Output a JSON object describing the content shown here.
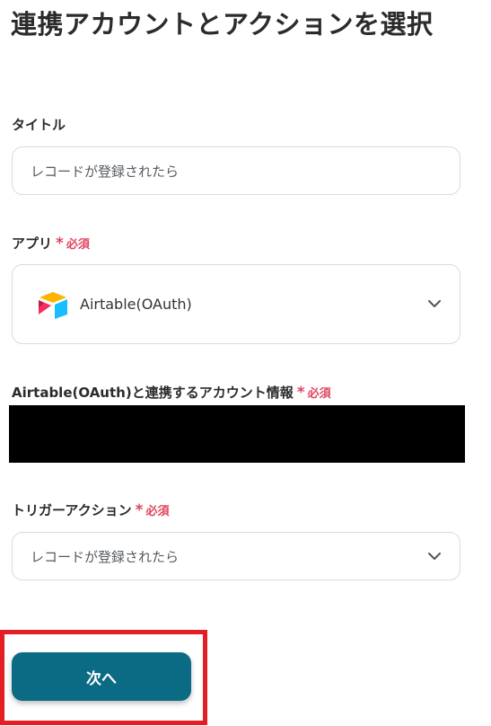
{
  "page": {
    "title": "連携アカウントとアクションを選択"
  },
  "title_field": {
    "label": "タイトル",
    "value": "レコードが登録されたら"
  },
  "app_field": {
    "label": "アプリ",
    "required_mark": "*",
    "required_text": "必須",
    "selected_app": "Airtable(OAuth)",
    "logo_icon": "airtable-logo-icon"
  },
  "account_field": {
    "label": "Airtable(OAuth)と連携するアカウント情報",
    "required_mark": "*",
    "required_text": "必須"
  },
  "trigger_field": {
    "label": "トリガーアクション",
    "required_mark": "*",
    "required_text": "必須",
    "selected_value": "レコードが登録されたら"
  },
  "actions": {
    "next_label": "次へ"
  },
  "colors": {
    "accent": "#0b6a84",
    "required": "#e0455f",
    "highlight": "#e31e24",
    "border": "#d8dbe0"
  }
}
